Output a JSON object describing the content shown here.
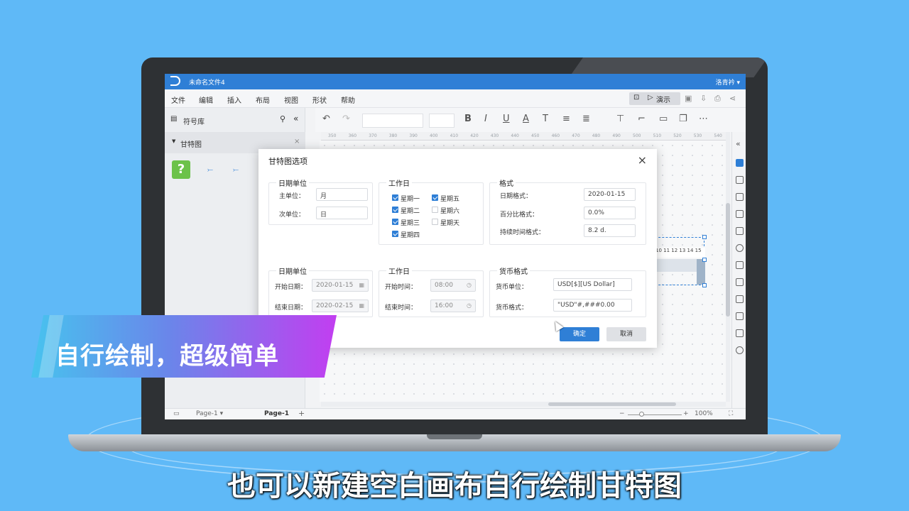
{
  "app": {
    "title": "未命名文件4",
    "user": "洛青衿 ▾"
  },
  "menu": [
    "文件",
    "编辑",
    "插入",
    "布局",
    "视图",
    "形状",
    "帮助"
  ],
  "present_label": "演示",
  "left_panel": {
    "title": "符号库",
    "section": "甘特图"
  },
  "ruler_ticks": [
    "350",
    "360",
    "370",
    "380",
    "390",
    "400",
    "410",
    "420",
    "430",
    "440",
    "450",
    "460",
    "470",
    "480",
    "490",
    "500",
    "510",
    "520",
    "530",
    "540"
  ],
  "gantt_header": "10 11 12 13 14 15",
  "status": {
    "page_select": "Page-1",
    "page_tab": "Page-1",
    "zoom": "100%"
  },
  "dialog": {
    "title": "甘特图选项",
    "date_unit": {
      "title": "日期单位",
      "main_label": "主单位：",
      "main_value": "月",
      "sub_label": "次单位：",
      "sub_value": "日"
    },
    "workdays": {
      "title": "工作日",
      "days": [
        {
          "label": "星期一",
          "checked": true
        },
        {
          "label": "星期五",
          "checked": true
        },
        {
          "label": "星期二",
          "checked": true
        },
        {
          "label": "星期六",
          "checked": false
        },
        {
          "label": "星期三",
          "checked": true
        },
        {
          "label": "星期天",
          "checked": false
        },
        {
          "label": "星期四",
          "checked": true
        }
      ]
    },
    "format": {
      "title": "格式",
      "date_label": "日期格式：",
      "date_value": "2020-01-15",
      "pct_label": "百分比格式：",
      "pct_value": "0.0%",
      "dur_label": "持续时间格式：",
      "dur_value": "8.2 d."
    },
    "date_range": {
      "title": "日期单位",
      "start_label": "开始日期：",
      "start_value": "2020-01-15",
      "end_label": "结束日期：",
      "end_value": "2020-02-15"
    },
    "worktime": {
      "title": "工作日",
      "start_label": "开始时间：",
      "start_value": "08:00",
      "end_label": "结束时间：",
      "end_value": "16:00"
    },
    "currency": {
      "title": "货币格式",
      "unit_label": "货币单位：",
      "unit_value": "USD[$][US Dollar]",
      "fmt_label": "货币格式：",
      "fmt_value": "\"USD\"#,###0.00"
    },
    "ok": "确定",
    "cancel": "取消"
  },
  "banner": "自行绘制，超级简单",
  "subtitle": "也可以新建空白画布自行绘制甘特图"
}
